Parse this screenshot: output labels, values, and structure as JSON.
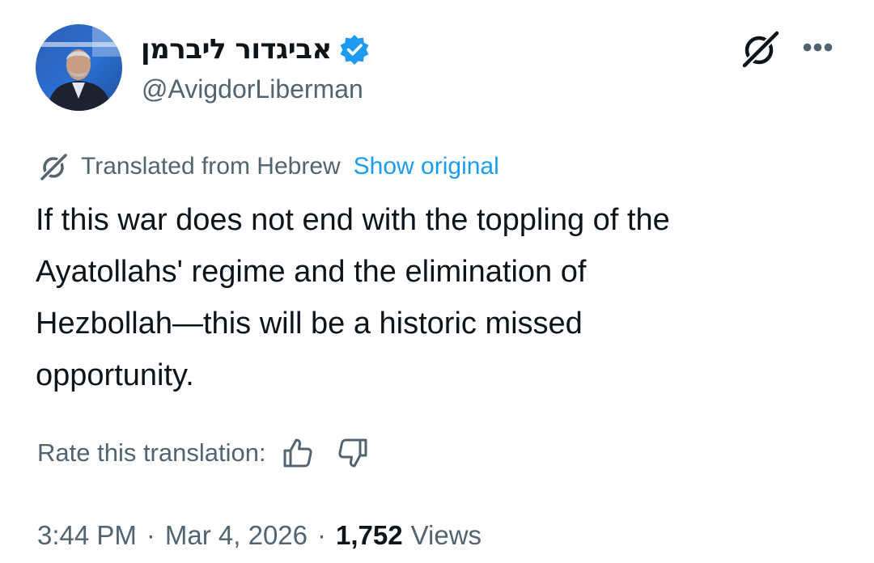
{
  "author": {
    "display_name": "אביגדור ליברמן",
    "handle": "@AvigdorLiberman",
    "verified_icon": "verified-badge-icon",
    "avatar_icon": "avatar"
  },
  "header_actions": {
    "grok_icon": "grok-icon",
    "more_label": "•••"
  },
  "translation": {
    "label": "Translated from Hebrew",
    "show_original": "Show original"
  },
  "tweet": {
    "text": "If this war does not end with the toppling of the\nAyatollahs' regime and the elimination of\nHezbollah—this will be a historic missed\nopportunity."
  },
  "rating": {
    "label": "Rate this translation:",
    "thumbs_up_icon": "thumbs-up-icon",
    "thumbs_down_icon": "thumbs-down-icon"
  },
  "meta": {
    "time": "3:44 PM",
    "separator": "·",
    "date": "Mar 4, 2026",
    "views_count": "1,752",
    "views_label": "Views"
  },
  "colors": {
    "accent": "#1d9bf0",
    "text_primary": "#0f1419",
    "text_secondary": "#536471"
  }
}
